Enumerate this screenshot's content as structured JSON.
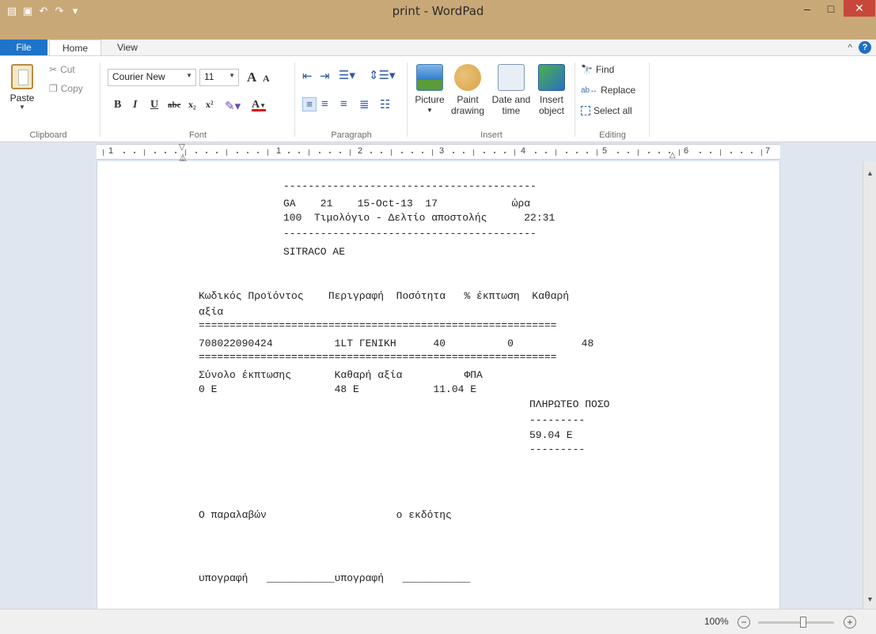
{
  "window": {
    "title": "print - WordPad",
    "minimize_glyph": "–",
    "maximize_glyph": "□",
    "close_glyph": "✕"
  },
  "ribbon_tabs": {
    "file": "File",
    "home": "Home",
    "view": "View",
    "collapse_glyph": "^",
    "help_glyph": "?"
  },
  "clipboard": {
    "paste": "Paste",
    "cut": "Cut",
    "copy": "Copy",
    "group": "Clipboard"
  },
  "font": {
    "family": "Courier New",
    "size": "11",
    "group": "Font",
    "bold": "B",
    "italic": "I",
    "underline": "U",
    "strike": "abc",
    "subscript": "x₂",
    "superscript": "x²",
    "grow": "A",
    "shrink": "A",
    "color_a": "A"
  },
  "paragraph": {
    "group": "Paragraph"
  },
  "insert": {
    "group": "Insert",
    "picture": "Picture",
    "paint1": "Paint",
    "paint2": "drawing",
    "date1": "Date and",
    "date2": "time",
    "object1": "Insert",
    "object2": "object"
  },
  "editing": {
    "group": "Editing",
    "find": "Find",
    "replace": "Replace",
    "select_all": "Select all"
  },
  "ruler": {
    "labels": [
      "1",
      "1",
      "2",
      "3",
      "4",
      "5",
      "6",
      "7"
    ]
  },
  "document": {
    "lines": [
      "-----------------------------------------",
      "GA    21    15-Oct-13  17            ώρα",
      "100  Τιμολόγιο - Δελτίο αποστολής      22:31",
      "-----------------------------------------",
      "SITRACO AE",
      "Κωδικός Προϊόντος    Περιγραφή  Ποσότητα   % έκπτωση  Καθαρή",
      "αξία",
      "==========================================================",
      "708022090424          1LT ΓΕΝΙΚΗ      40          0           48",
      "==========================================================",
      "Σύνολο έκπτωσης       Καθαρή αξία          ΦΠΑ",
      "0 Ε                   48 Ε            11.04 Ε",
      "ΠΛΗΡΩΤΕΟ ΠΟΣΟ",
      "---------",
      "59.04 Ε",
      "---------",
      "Ο παραλαβών                     ο εκδότης",
      "υπογραφή   ___________υπογραφή   ___________"
    ]
  },
  "status": {
    "zoom": "100%",
    "zoom_out": "−",
    "zoom_in": "+"
  }
}
